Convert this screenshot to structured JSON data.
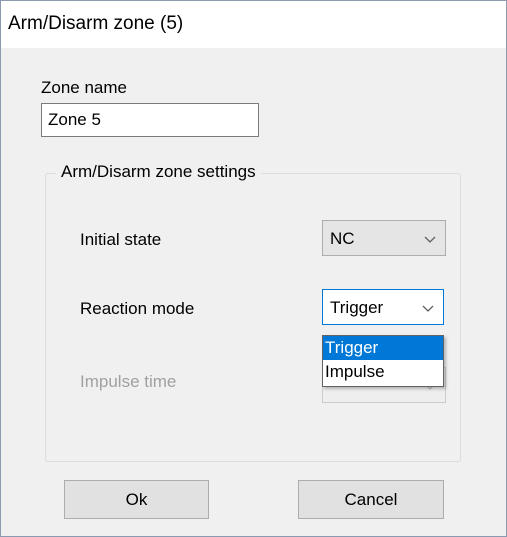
{
  "window": {
    "title": "Arm/Disarm zone (5)"
  },
  "zone_name": {
    "label": "Zone name",
    "value": "Zone 5"
  },
  "settings_group": {
    "caption": "Arm/Disarm zone settings",
    "initial_state": {
      "label": "Initial state",
      "value": "NC"
    },
    "reaction_mode": {
      "label": "Reaction mode",
      "value": "Trigger",
      "options": [
        "Trigger",
        "Impulse"
      ],
      "highlighted_option": "Trigger",
      "dropdown_open": true
    },
    "impulse_time": {
      "label": "Impulse time",
      "enabled": false
    }
  },
  "buttons": {
    "ok": "Ok",
    "cancel": "Cancel"
  },
  "colors": {
    "accent": "#0078d7",
    "dialog_background": "#f0f0f0",
    "disabled_text": "#a0a0a0"
  },
  "icons": {
    "combo_arrow": "chevron-down-icon"
  }
}
